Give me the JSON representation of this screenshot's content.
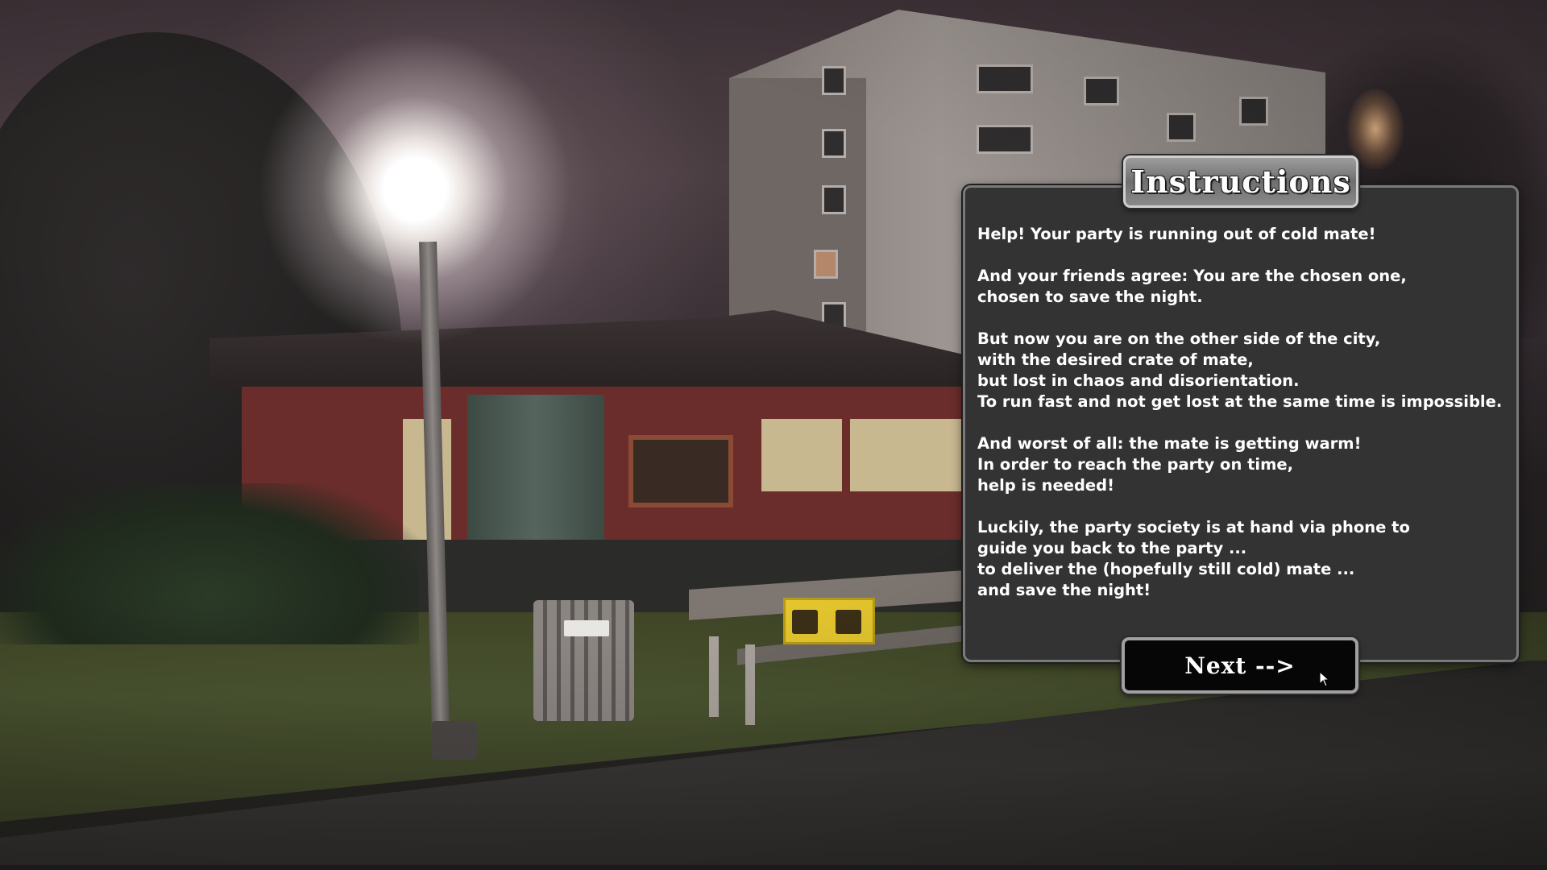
{
  "instructions": {
    "title": "Instructions",
    "paragraphs": [
      [
        "Help! Your party is running out of cold mate!"
      ],
      [
        "And your friends agree: You are the chosen one,",
        "chosen to save the night."
      ],
      [
        "But now you are on the other side of the city,",
        "with the desired crate of mate,",
        "but lost in chaos and disorientation.",
        "To run fast and not get lost at the same time is impossible."
      ],
      [
        "And worst of all: the mate is getting warm!",
        "In order to reach the party on time,",
        "help is needed!"
      ],
      [
        "Luckily, the party society is at hand via phone to",
        "guide you back to the party ...",
        "to deliver the (hopefully still cold) mate ...",
        "and save the night!"
      ]
    ],
    "next_label": "Next -->"
  },
  "scene": {
    "description_icons": [
      "street-lamp",
      "park-bench",
      "trash-bin",
      "mate-crate",
      "apartment-building",
      "pavilion"
    ]
  },
  "colors": {
    "panel_bg": "#333333",
    "panel_border": "#7a7a7a",
    "button_bg": "#060606",
    "text": "#ffffff",
    "crate": "#e4c62e"
  }
}
